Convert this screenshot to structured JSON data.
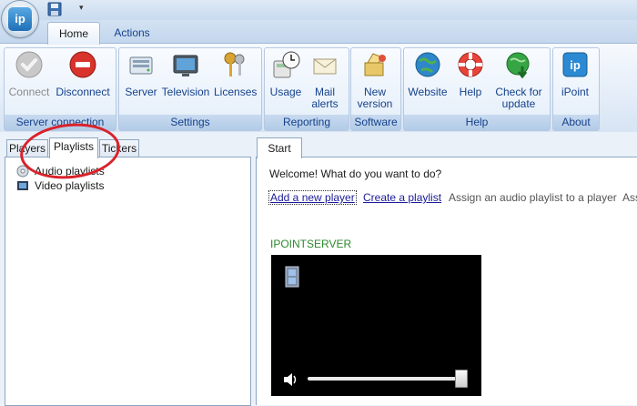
{
  "app": {
    "logo_text": "ip"
  },
  "ribbon": {
    "tabs": [
      {
        "label": "Home",
        "active": true
      },
      {
        "label": "Actions",
        "active": false
      }
    ],
    "groups": [
      {
        "label": "Server connection",
        "buttons": [
          {
            "label": "Connect",
            "icon": "check-circle-icon",
            "enabled": false
          },
          {
            "label": "Disconnect",
            "icon": "stop-circle-icon",
            "enabled": true
          }
        ]
      },
      {
        "label": "Settings",
        "buttons": [
          {
            "label": "Server",
            "icon": "server-icon"
          },
          {
            "label": "Television",
            "icon": "television-icon"
          },
          {
            "label": "Licenses",
            "icon": "keys-icon"
          }
        ]
      },
      {
        "label": "Reporting",
        "buttons": [
          {
            "label": "Usage",
            "icon": "clock-calculator-icon"
          },
          {
            "label": "Mail alerts",
            "label_lines": [
              "Mail",
              "alerts"
            ],
            "icon": "envelope-icon"
          }
        ]
      },
      {
        "label": "Software",
        "buttons": [
          {
            "label": "New version",
            "label_lines": [
              "New",
              "version"
            ],
            "icon": "new-version-icon"
          }
        ]
      },
      {
        "label": "Help",
        "buttons": [
          {
            "label": "Website",
            "icon": "globe-icon"
          },
          {
            "label": "Help",
            "icon": "lifebuoy-icon"
          },
          {
            "label": "Check for update",
            "label_lines": [
              "Check for",
              "update"
            ],
            "icon": "globe-update-icon"
          }
        ]
      },
      {
        "label": "About",
        "buttons": [
          {
            "label": "iPoint",
            "icon": "ipoint-logo-icon"
          }
        ]
      }
    ]
  },
  "left_panel": {
    "tabs": [
      {
        "label": "Players",
        "active": false
      },
      {
        "label": "Playlists",
        "active": true
      },
      {
        "label": "Tickers",
        "active": false
      }
    ],
    "tree": [
      {
        "label": "Audio playlists",
        "icon": "audio-cd-icon"
      },
      {
        "label": "Video playlists",
        "icon": "video-film-icon"
      }
    ]
  },
  "main": {
    "tab": "Start",
    "welcome": "Welcome! What do you want to do?",
    "links": [
      "Add a new player",
      "Create a playlist",
      "Assign an audio playlist to a player",
      "Ass"
    ],
    "server_name": "IPOINTSERVER",
    "player": {
      "volume_fraction": 0.98
    }
  },
  "colors": {
    "accent": "#15428b",
    "server_name": "#2d8a2d",
    "annotation": "#d9222a"
  }
}
